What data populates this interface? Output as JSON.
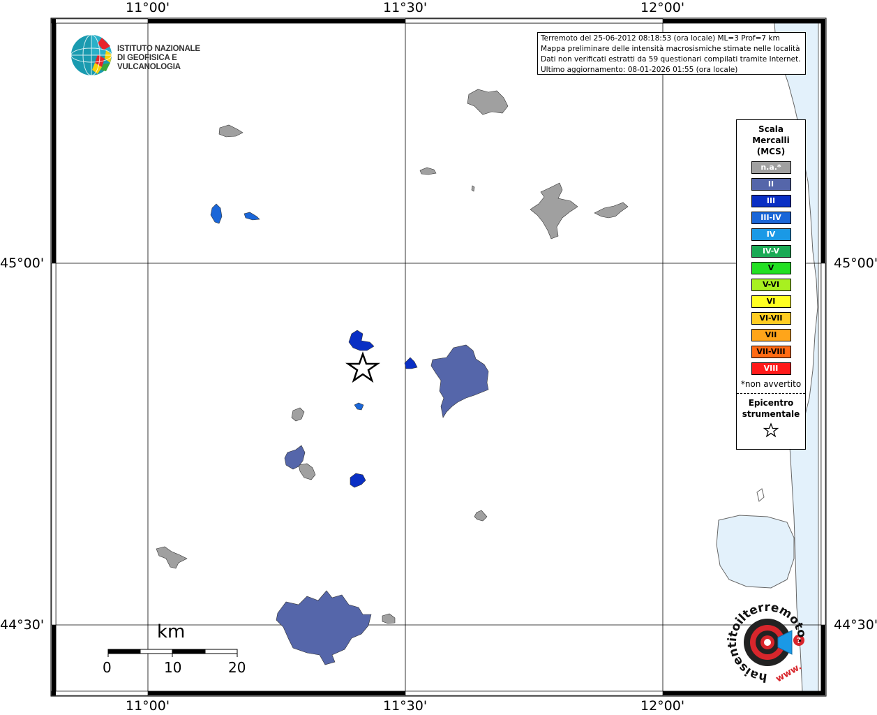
{
  "map": {
    "lon_labels": [
      "11°00'",
      "11°30'",
      "12°00'"
    ],
    "lat_labels": [
      "45°00'",
      "44°30'"
    ]
  },
  "logo": {
    "line1": "ISTITUTO NAZIONALE",
    "line2": "DI GEOFISICA E VULCANOLOGIA"
  },
  "info": {
    "line1": "Terremoto del 25-06-2012 08:18:53 (ora locale) ML=3 Prof=7 km",
    "line2": "Mappa preliminare delle intensità macrosismiche stimate nelle località",
    "line3": "Dati non verificati estratti da 59 questionari compilati tramite Internet.",
    "line4": "Ultimo aggiornamento: 08-01-2026 01:55 (ora locale)"
  },
  "legend": {
    "title_line1": "Scala",
    "title_line2": "Mercalli",
    "title_line3": "(MCS)",
    "items": [
      {
        "label": "n.a.*",
        "color": "#a0a0a0",
        "text_color": "#ffffff"
      },
      {
        "label": "II",
        "color": "#5566aa",
        "text_color": "#ffffff"
      },
      {
        "label": "III",
        "color": "#0a2fc4",
        "text_color": "#ffffff"
      },
      {
        "label": "III-IV",
        "color": "#1a66d8",
        "text_color": "#ffffff"
      },
      {
        "label": "IV",
        "color": "#1a99e6",
        "text_color": "#ffffff"
      },
      {
        "label": "IV-V",
        "color": "#1aaa55",
        "text_color": "#ffffff"
      },
      {
        "label": "V",
        "color": "#22e022",
        "text_color": "#000000"
      },
      {
        "label": "V-VI",
        "color": "#a8f020",
        "text_color": "#000000"
      },
      {
        "label": "VI",
        "color": "#ffff22",
        "text_color": "#000000"
      },
      {
        "label": "VI-VII",
        "color": "#ffcc22",
        "text_color": "#000000"
      },
      {
        "label": "VII",
        "color": "#ffa51a",
        "text_color": "#000000"
      },
      {
        "label": "VII-VIII",
        "color": "#ff6a14",
        "text_color": "#000000"
      },
      {
        "label": "VIII",
        "color": "#ff1a1a",
        "text_color": "#ffffff"
      }
    ],
    "note": "*non avvertito",
    "epi_line1": "Epicentro",
    "epi_line2": "strumentale"
  },
  "scale_bar": {
    "unit": "km",
    "ticks": [
      "0",
      "10",
      "20"
    ]
  },
  "brand": {
    "text": "haisentitoilterremoto.it",
    "www": "www."
  },
  "colors": {
    "sea": "#e3f1fb",
    "coast": "#555555",
    "not_felt": "#a0a0a0",
    "intensity_II": "#5566aa",
    "intensity_III": "#0a2fc4",
    "intensity_III_IV": "#1a66d8"
  }
}
